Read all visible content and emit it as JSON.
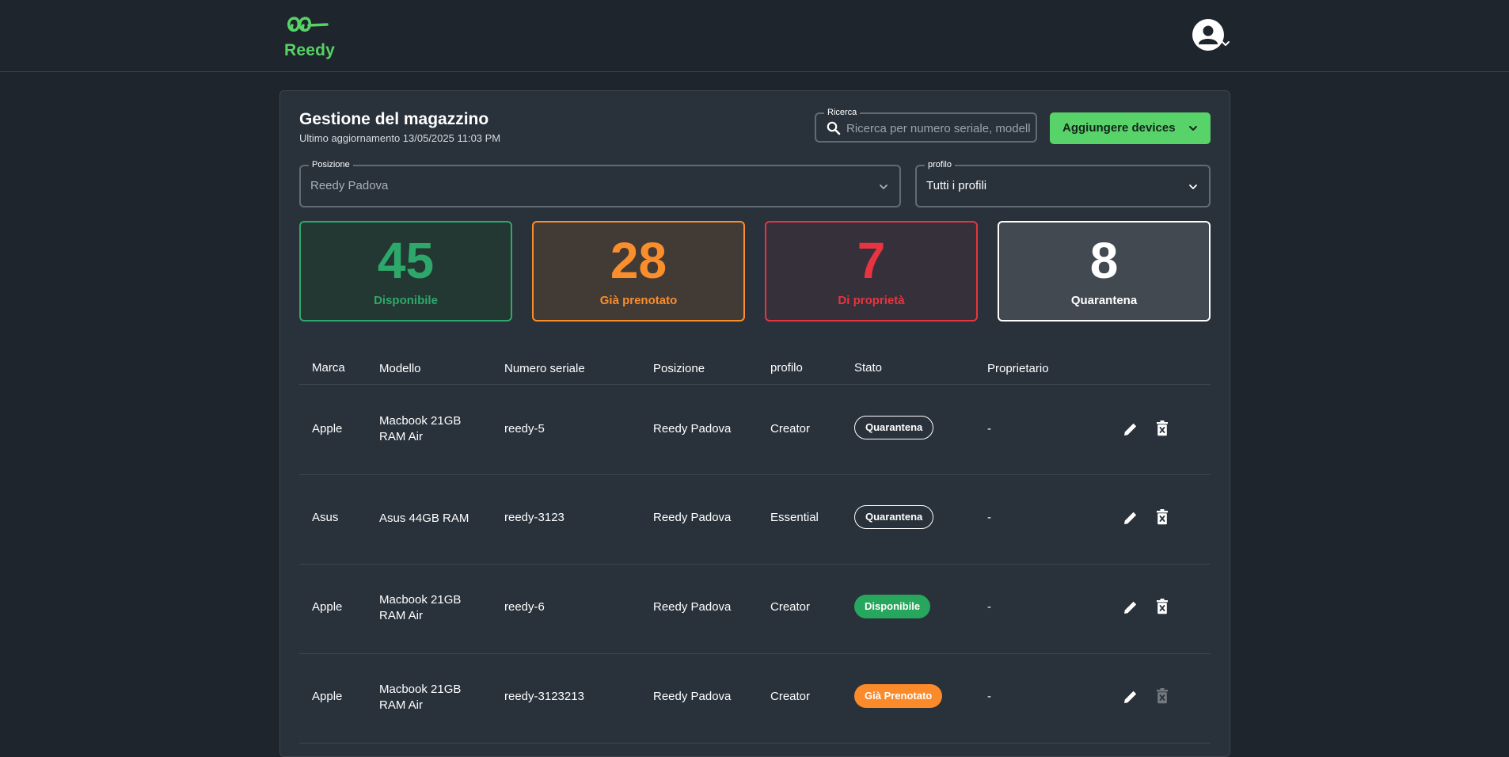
{
  "brand": {
    "name": "Reedy",
    "accent": "#56d364"
  },
  "header": {
    "logo_icon": "reedy-logo-icon",
    "user_icon": "user-avatar-icon"
  },
  "page": {
    "title": "Gestione del magazzino",
    "last_updated": "Ultimo aggiornamento 13/05/2025 11:03 PM"
  },
  "search": {
    "label": "Ricerca",
    "placeholder": "Ricerca per numero seriale, modello"
  },
  "add_button": {
    "label": "Aggiungere devices"
  },
  "filters": {
    "position": {
      "label": "Posizione",
      "value": "Reedy Padova"
    },
    "profile": {
      "label": "profilo",
      "value": "Tutti i profili"
    }
  },
  "stats": [
    {
      "value": "45",
      "label": "Disponibile",
      "color": "#2ea86a"
    },
    {
      "value": "28",
      "label": "Già prenotato",
      "color": "#fb8e2c"
    },
    {
      "value": "7",
      "label": "Di proprietà",
      "color": "#e83440"
    },
    {
      "value": "8",
      "label": "Quarantena",
      "color": "#ffffff"
    }
  ],
  "table": {
    "columns": [
      "Marca",
      "Modello",
      "Numero seriale",
      "Posizione",
      "profilo",
      "Stato",
      "Proprietario"
    ],
    "rows": [
      {
        "brand": "Apple",
        "model_line1": "Macbook 21GB",
        "model_line2": "RAM Air",
        "serial": "reedy-5",
        "position": "Reedy Padova",
        "profile": "Creator",
        "status": "Quarantena",
        "owner": "-"
      },
      {
        "brand": "Asus",
        "model_line1": "Asus 44GB RAM",
        "model_line2": "",
        "serial": "reedy-3123",
        "position": "Reedy Padova",
        "profile": "Essential",
        "status": "Quarantena",
        "owner": "-"
      },
      {
        "brand": "Apple",
        "model_line1": "Macbook 21GB",
        "model_line2": "RAM Air",
        "serial": "reedy-6",
        "position": "Reedy Padova",
        "profile": "Creator",
        "status": "Disponibile",
        "owner": "-"
      },
      {
        "brand": "Apple",
        "model_line1": "Macbook 21GB",
        "model_line2": "RAM Air",
        "serial": "reedy-3123213",
        "position": "Reedy Padova",
        "profile": "Creator",
        "status": "Già Prenotato",
        "owner": "-"
      }
    ],
    "status_colors": {
      "Disponibile": "#27a65e",
      "Già Prenotato": "#fb8a2a",
      "Quarantena": "transparent"
    },
    "actions": {
      "edit_icon": "pencil-icon",
      "delete_icon": "trash-icon"
    }
  }
}
